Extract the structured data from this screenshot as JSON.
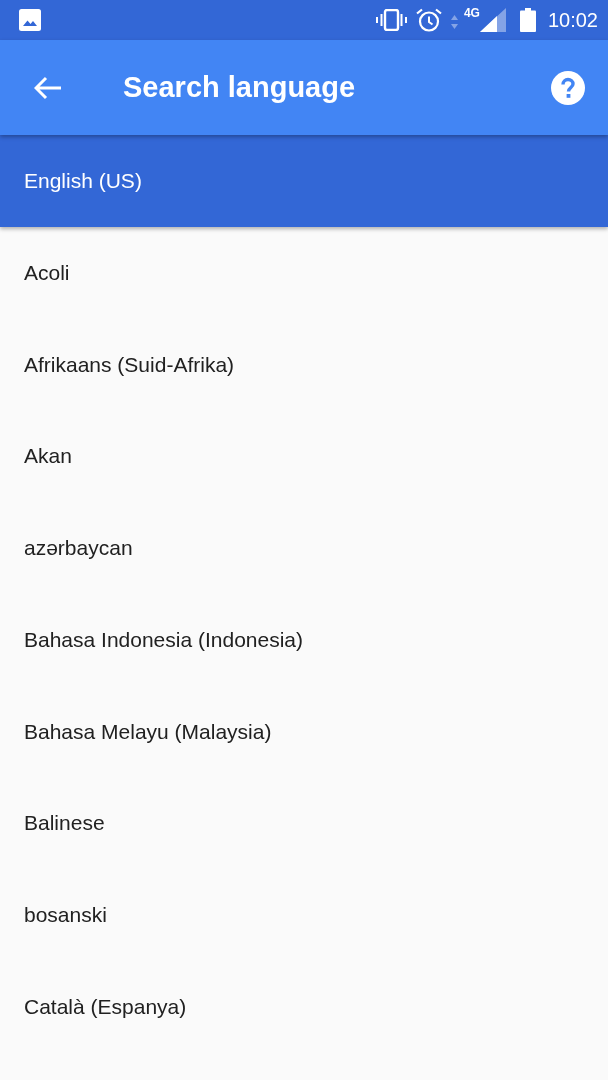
{
  "status_bar": {
    "network_type": "4G",
    "time": "10:02"
  },
  "app_bar": {
    "title": "Search language"
  },
  "languages": [
    {
      "label": "English (US)",
      "selected": true
    },
    {
      "label": "Acoli",
      "selected": false
    },
    {
      "label": "Afrikaans (Suid-Afrika)",
      "selected": false
    },
    {
      "label": "Akan",
      "selected": false
    },
    {
      "label": "azərbaycan",
      "selected": false
    },
    {
      "label": "Bahasa Indonesia (Indonesia)",
      "selected": false
    },
    {
      "label": "Bahasa Melayu (Malaysia)",
      "selected": false
    },
    {
      "label": "Balinese",
      "selected": false
    },
    {
      "label": "bosanski",
      "selected": false
    },
    {
      "label": "Català (Espanya)",
      "selected": false
    }
  ]
}
